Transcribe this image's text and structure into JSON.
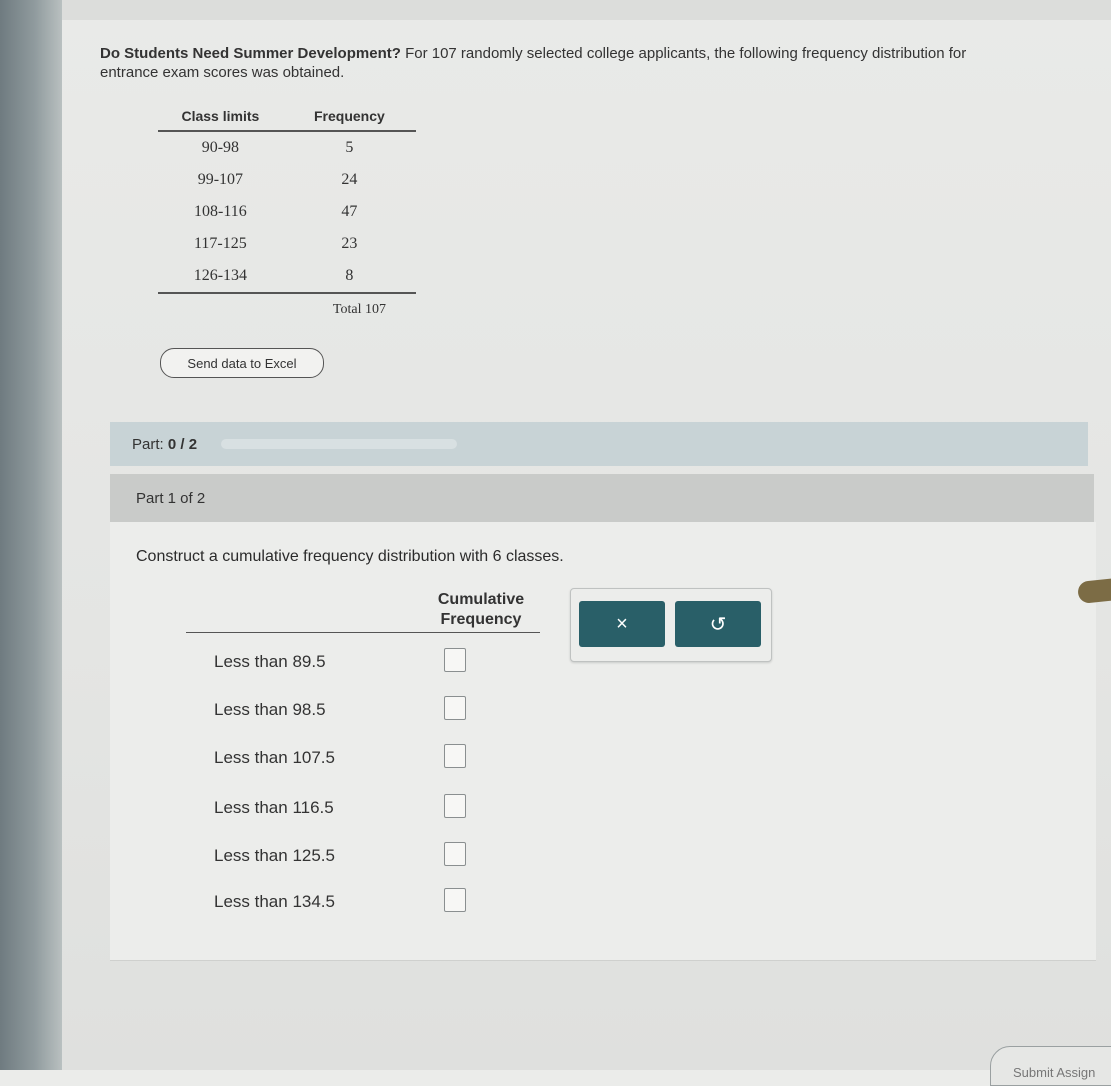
{
  "problem": {
    "title": "Do Students Need Summer Development?",
    "text": "For 107 randomly selected college applicants, the following frequency distribution for entrance exam scores was obtained."
  },
  "freq_table": {
    "headers": [
      "Class limits",
      "Frequency"
    ],
    "rows": [
      {
        "limits": "90-98",
        "frequency": "5"
      },
      {
        "limits": "99-107",
        "frequency": "24"
      },
      {
        "limits": "108-116",
        "frequency": "47"
      },
      {
        "limits": "117-125",
        "frequency": "23"
      },
      {
        "limits": "126-134",
        "frequency": "8"
      }
    ],
    "total_label": "Total",
    "total_value": "107"
  },
  "excel_button": "Send data to Excel",
  "progress": {
    "label": "Part:",
    "value": "0 / 2",
    "fraction": 0.0
  },
  "part_header": "Part 1 of 2",
  "instruction": "Construct a cumulative frequency distribution with 6 classes.",
  "cumulative_table": {
    "header_line1": "Cumulative",
    "header_line2": "Frequency",
    "rows": [
      {
        "bound": "Less than 89.5",
        "value": ""
      },
      {
        "bound": "Less than 98.5",
        "value": ""
      },
      {
        "bound": "Less than 107.5",
        "value": ""
      },
      {
        "bound": "Less than 116.5",
        "value": ""
      },
      {
        "bound": "Less than 125.5",
        "value": ""
      },
      {
        "bound": "Less than 134.5",
        "value": ""
      }
    ]
  },
  "actions": {
    "clear_icon": "×",
    "undo_icon": "↺"
  },
  "submit": "Submit Assign"
}
